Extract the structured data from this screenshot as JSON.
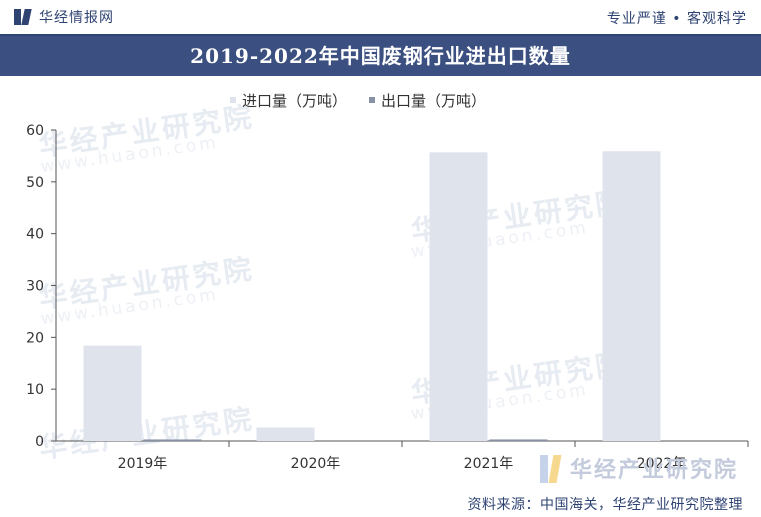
{
  "header": {
    "brand_name": "华经情报网",
    "tagline": "专业严谨 • 客观科学"
  },
  "watermark": {
    "text": "华经产业研究院",
    "url": "www.huaon.com"
  },
  "footer": {
    "brand_name": "华经产业研究院",
    "source": "资料来源：中国海关，华经产业研究院整理"
  },
  "colors": {
    "import": "#dfe3ec",
    "export": "#8791a8",
    "title_bar": "#3b5080",
    "brand": "#2f4373"
  },
  "chart_data": {
    "type": "bar",
    "title": "2019-2022年中国废钢行业进出口数量",
    "categories": [
      "2019年",
      "2020年",
      "2021年",
      "2022年"
    ],
    "series": [
      {
        "name": "进口量（万吨）",
        "values": [
          18.4,
          2.6,
          55.7,
          55.9
        ]
      },
      {
        "name": "出口量（万吨）",
        "values": [
          0.3,
          0.0,
          0.3,
          0.0
        ]
      }
    ],
    "ylim": [
      0,
      60
    ],
    "yticks": [
      "0",
      "10",
      "20",
      "30",
      "40",
      "50",
      "60"
    ],
    "xlabel": "",
    "ylabel": "",
    "legend": "top-center",
    "grid": false
  }
}
